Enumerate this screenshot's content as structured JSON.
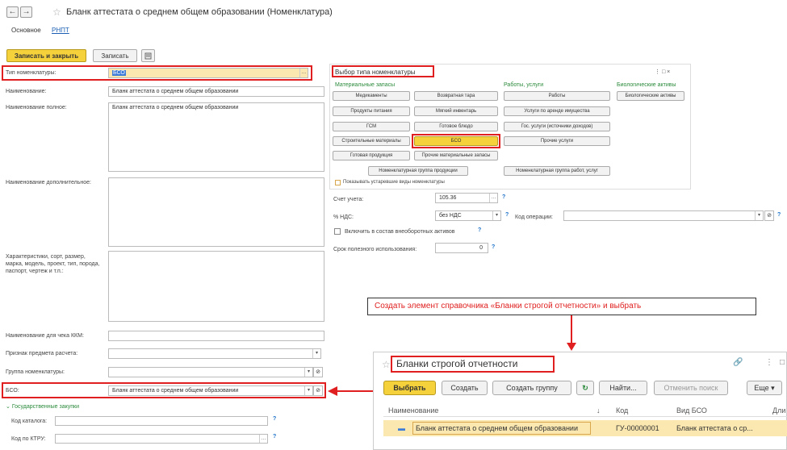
{
  "window": {
    "title": "Бланк аттестата о среднем общем образовании (Номенклатура)",
    "back": "←",
    "forward": "→",
    "star": "☆"
  },
  "tabs": {
    "main": "Основное",
    "rnpt": "РНПТ"
  },
  "toolbar": {
    "save_close": "Записать и закрыть",
    "save": "Записать"
  },
  "form": {
    "type_label": "Тип номенклатуры:",
    "type_value": "БСО",
    "name_label": "Наименование:",
    "name_value": "Бланк аттестата о среднем общем образовании",
    "fullname_label": "Наименование полное:",
    "fullname_value": "Бланк аттестата о среднем общем образовании",
    "addname_label": "Наименование дополнительное:",
    "chars_label": "Характеристики, сорт, размер, марка, модель, проект, тип, порода, паспорт, чертеж и т.п.:",
    "kkm_label": "Наименование для чека ККМ:",
    "payment_label": "Признак предмета расчета:",
    "group_label": "Группа номенклатуры:",
    "bso_label": "БСО:",
    "bso_value": "Бланк аттестата о среднем общем образовании",
    "gov_section": "Государственные закупки",
    "catalog_label": "Код каталога:",
    "ktru_label": "Код по КТРУ:"
  },
  "picker": {
    "title": "Выбор типа номенклатуры",
    "window_controls": "⋮  □  ×",
    "groups": {
      "material": "Материальные запасы",
      "works": "Работы, услуги",
      "bio": "Биологические активы"
    },
    "buttons": {
      "medicines": "Медикаменты",
      "returnable": "Возвратная тара",
      "works": "Работы",
      "bio_assets": "Биологические активы",
      "food": "Продукты питания",
      "soft_inventory": "Мягкий инвентарь",
      "rent": "Услуги по аренде имущества",
      "gsm": "ГСМ",
      "ready_meals": "Готовое блюдо",
      "gov_services": "Гос. услуги (источники доходов)",
      "construction": "Строительные материалы",
      "bso": "БСО",
      "other_services": "Прочие услуги",
      "finished_products": "Готовая продукция",
      "other_materials": "Прочие материальные запасы",
      "product_group": "Номенклатурная группа продукции",
      "works_group": "Номенклатурная группа работ, услуг"
    },
    "show_obsolete": "Показывать устаревшие виды номенклатуры"
  },
  "accounting": {
    "account_label": "Счет учета:",
    "account_value": "105.36",
    "vat_label": "% НДС:",
    "vat_value": "без НДС",
    "operation_label": "Код операции:",
    "include_label": "Включить в состав внеоборотных активов",
    "life_label": "Срок полезного использования:",
    "life_value": "0"
  },
  "callout": "Создать элемент справочника «Бланки строгой отчетности» и выбрать",
  "subwindow": {
    "title": "Бланки строгой отчетности",
    "buttons": {
      "select": "Выбрать",
      "create": "Создать",
      "create_group": "Создать группу",
      "find": "Найти...",
      "cancel_search": "Отменить поиск",
      "more": "Еще"
    },
    "columns": {
      "name": "Наименование",
      "code": "Код",
      "type": "Вид БСО",
      "len": "Дли"
    },
    "row": {
      "marker": "▬",
      "name": "Бланк аттестата о среднем общем образовании",
      "code": "ГУ-00000001",
      "type": "Бланк аттестата о ср..."
    }
  },
  "colors": {
    "accent": "#f5d13c",
    "red": "#e02020",
    "green": "#2a8a3a"
  }
}
